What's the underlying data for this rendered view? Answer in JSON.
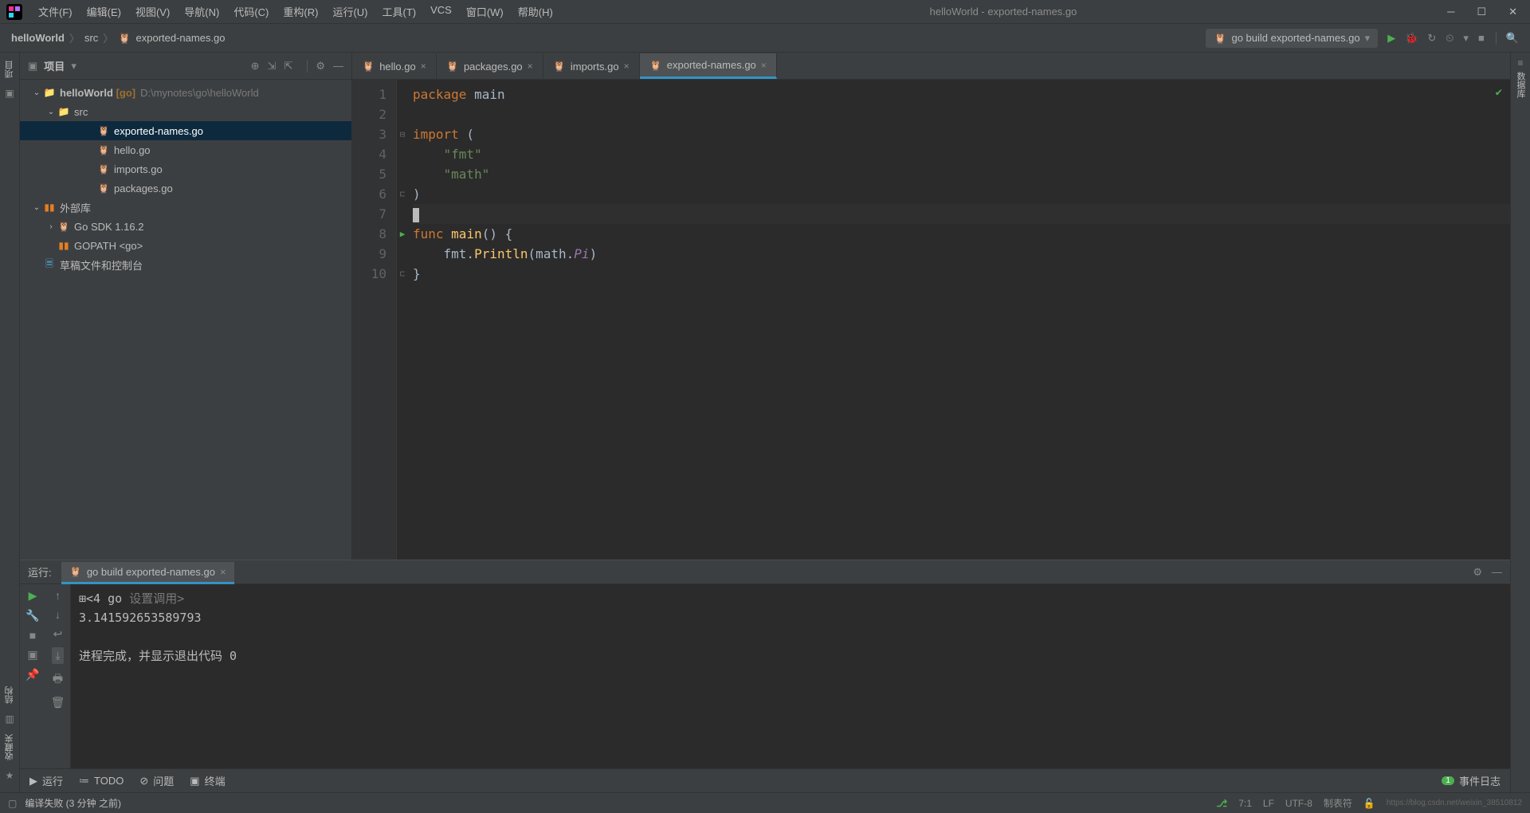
{
  "window_title": "helloWorld - exported-names.go",
  "menus": [
    "文件(F)",
    "编辑(E)",
    "视图(V)",
    "导航(N)",
    "代码(C)",
    "重构(R)",
    "运行(U)",
    "工具(T)",
    "VCS",
    "窗口(W)",
    "帮助(H)"
  ],
  "breadcrumb": {
    "root": "helloWorld",
    "src": "src",
    "file": "exported-names.go"
  },
  "run_config": "go build exported-names.go",
  "project_panel": {
    "title": "项目",
    "root": {
      "name": "helloWorld",
      "badge": "[go]",
      "path": "D:\\mynotes\\go\\helloWorld"
    },
    "src": "src",
    "files": [
      "exported-names.go",
      "hello.go",
      "imports.go",
      "packages.go"
    ],
    "ext_lib": "外部库",
    "sdk": "Go SDK 1.16.2",
    "gopath": "GOPATH <go>",
    "scratch": "草稿文件和控制台"
  },
  "tabs": [
    {
      "name": "hello.go"
    },
    {
      "name": "packages.go"
    },
    {
      "name": "imports.go"
    },
    {
      "name": "exported-names.go",
      "active": true
    }
  ],
  "code": {
    "l1_kw": "package",
    "l1_pkg": " main",
    "l3_kw": "import",
    "l3_rest": " (",
    "l4": "    \"fmt\"",
    "l5": "    \"math\"",
    "l6": ")",
    "l8_kw": "func ",
    "l8_fn": "main",
    "l8_rest": "() {",
    "l9_pre": "    fmt.",
    "l9_fn": "Println",
    "l9_open": "(math.",
    "l9_prop": "Pi",
    "l9_close": ")",
    "l10": "}"
  },
  "run_panel": {
    "label": "运行:",
    "tab": "go build exported-names.go",
    "setup_prefix": "<4 go ",
    "setup_hint": "设置调用>",
    "output": "3.141592653589793",
    "exit": "进程完成，并显示退出代码 0"
  },
  "bottom_tools": {
    "run": "运行",
    "todo": "TODO",
    "problems": "问题",
    "terminal": "终端",
    "events": "事件日志",
    "event_count": "1"
  },
  "status": {
    "left": "编译失败 (3 分钟 之前)",
    "pos": "7:1",
    "enc": "LF",
    "charset": "UTF-8",
    "spaces": "制表符"
  },
  "left_sidebar": {
    "project": "项目",
    "structure": "结构",
    "favorites": "收藏夹"
  },
  "right_sidebar": {
    "db": "数据库"
  },
  "watermark": "https://blog.csdn.net/weixin_38510812"
}
